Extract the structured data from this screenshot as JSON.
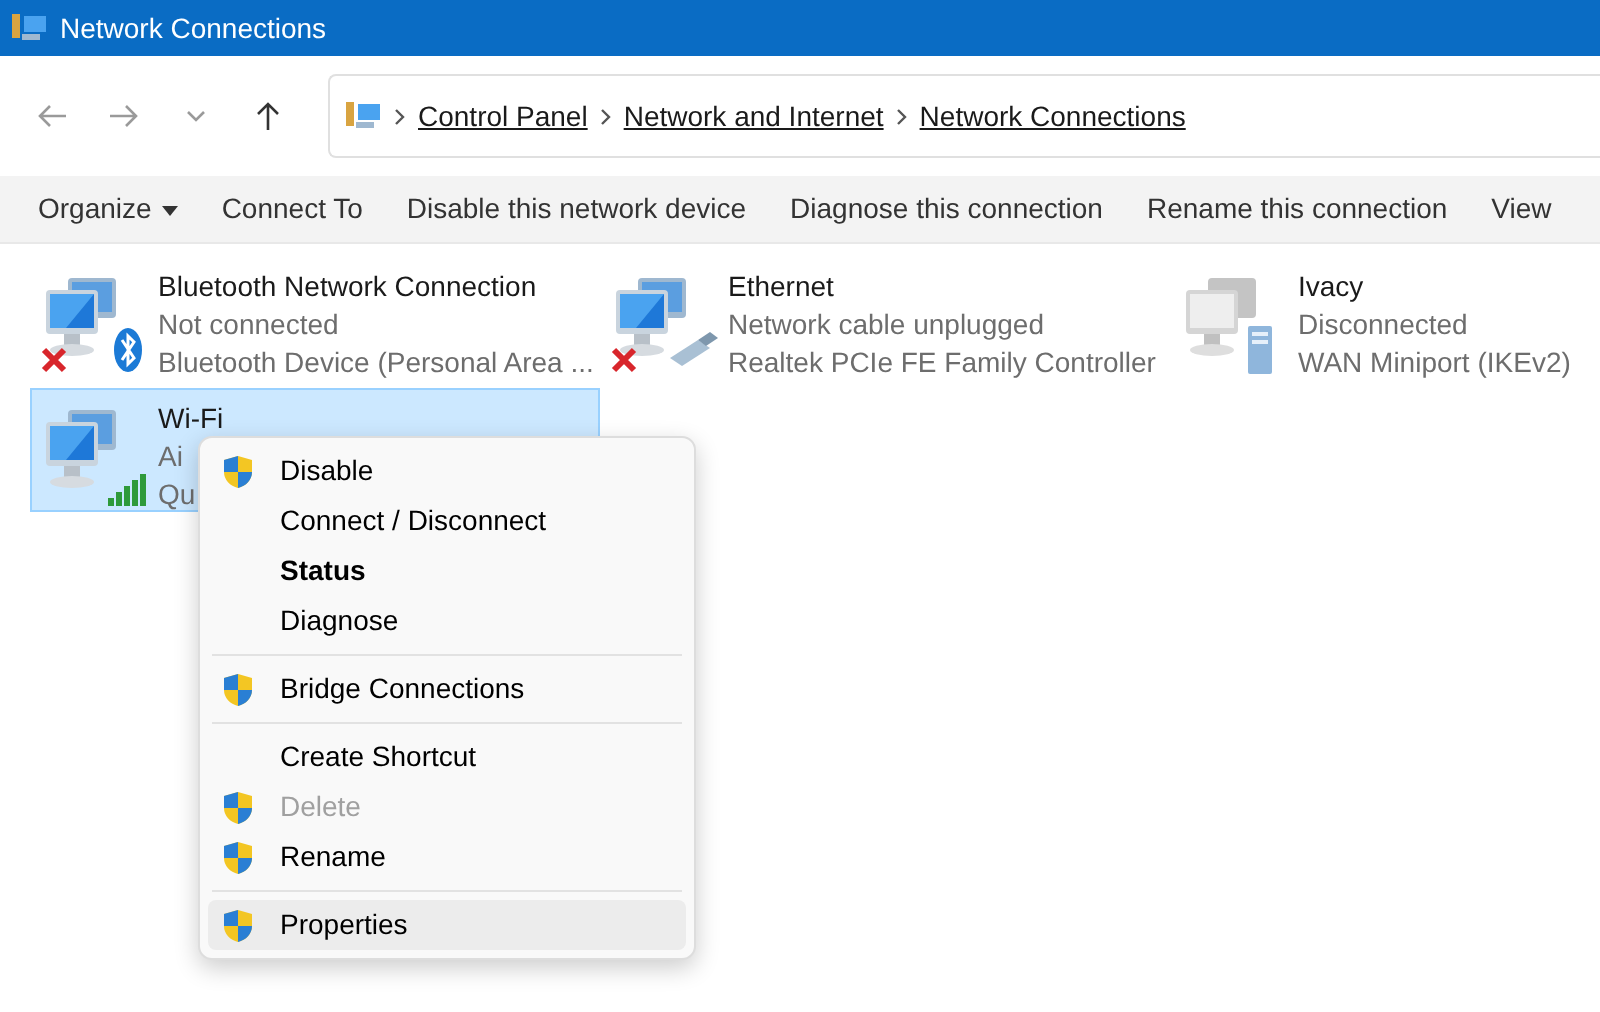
{
  "window": {
    "title": "Network Connections"
  },
  "nav": [
    {
      "kind": "back",
      "disabled": true
    },
    {
      "kind": "forward",
      "disabled": true
    },
    {
      "kind": "recent",
      "disabled": true
    },
    {
      "kind": "up",
      "disabled": false
    }
  ],
  "breadcrumb": [
    "Control Panel",
    "Network and Internet",
    "Network Connections"
  ],
  "commands": [
    {
      "label": "Organize",
      "dropdown": true
    },
    {
      "label": "Connect To",
      "dropdown": false
    },
    {
      "label": "Disable this network device",
      "dropdown": false
    },
    {
      "label": "Diagnose this connection",
      "dropdown": false
    },
    {
      "label": "Rename this connection",
      "dropdown": false
    },
    {
      "label": "View",
      "dropdown": false
    }
  ],
  "connections": [
    {
      "name": "Bluetooth Network Connection",
      "status": "Not connected",
      "device": "Bluetooth Device (Personal Area ...",
      "kind": "bluetooth",
      "error": true,
      "selected": false
    },
    {
      "name": "Ethernet",
      "status": "Network cable unplugged",
      "device": "Realtek PCIe FE Family Controller",
      "kind": "cable",
      "error": true,
      "selected": false
    },
    {
      "name": "Ivacy",
      "status": "Disconnected",
      "device": "WAN Miniport (IKEv2)",
      "kind": "server",
      "error": false,
      "selected": false
    },
    {
      "name": "Wi-Fi",
      "status": "Ai",
      "device": "Qu",
      "kind": "signal",
      "error": false,
      "selected": true
    }
  ],
  "context_menu": {
    "groups": [
      [
        {
          "label": "Disable",
          "shield": true,
          "default": false,
          "disabled": false,
          "selected": false
        },
        {
          "label": "Connect / Disconnect",
          "shield": false,
          "default": false,
          "disabled": false,
          "selected": false
        },
        {
          "label": "Status",
          "shield": false,
          "default": true,
          "disabled": false,
          "selected": false
        },
        {
          "label": "Diagnose",
          "shield": false,
          "default": false,
          "disabled": false,
          "selected": false
        }
      ],
      [
        {
          "label": "Bridge Connections",
          "shield": true,
          "default": false,
          "disabled": false,
          "selected": false
        }
      ],
      [
        {
          "label": "Create Shortcut",
          "shield": false,
          "default": false,
          "disabled": false,
          "selected": false
        },
        {
          "label": "Delete",
          "shield": true,
          "default": false,
          "disabled": true,
          "selected": false
        },
        {
          "label": "Rename",
          "shield": true,
          "default": false,
          "disabled": false,
          "selected": false
        }
      ],
      [
        {
          "label": "Properties",
          "shield": true,
          "default": false,
          "disabled": false,
          "selected": true
        }
      ]
    ]
  }
}
